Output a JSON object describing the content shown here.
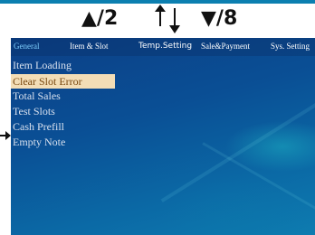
{
  "nav_hints": {
    "page_up": "▲/2",
    "page_down": "▼/8"
  },
  "tabs": [
    {
      "label": "General",
      "active": true
    },
    {
      "label": "Item & Slot",
      "active": false
    },
    {
      "label": "Temp.Setting",
      "active": false
    },
    {
      "label": "Sale&Payment",
      "active": false
    },
    {
      "label": "Sys. Setting",
      "active": false
    }
  ],
  "menu_items": [
    {
      "label": "Item Loading",
      "selected": false
    },
    {
      "label": "Clear Slot Error",
      "selected": true
    },
    {
      "label": "Total Sales",
      "selected": false
    },
    {
      "label": "Test Slots",
      "selected": false
    },
    {
      "label": "Cash Prefill",
      "selected": false
    },
    {
      "label": "Empty Note",
      "selected": false
    }
  ],
  "colors": {
    "active_tab": "#7fd0ff",
    "selected_bg": "#f3ddb6",
    "selected_text": "#7a4a12"
  }
}
